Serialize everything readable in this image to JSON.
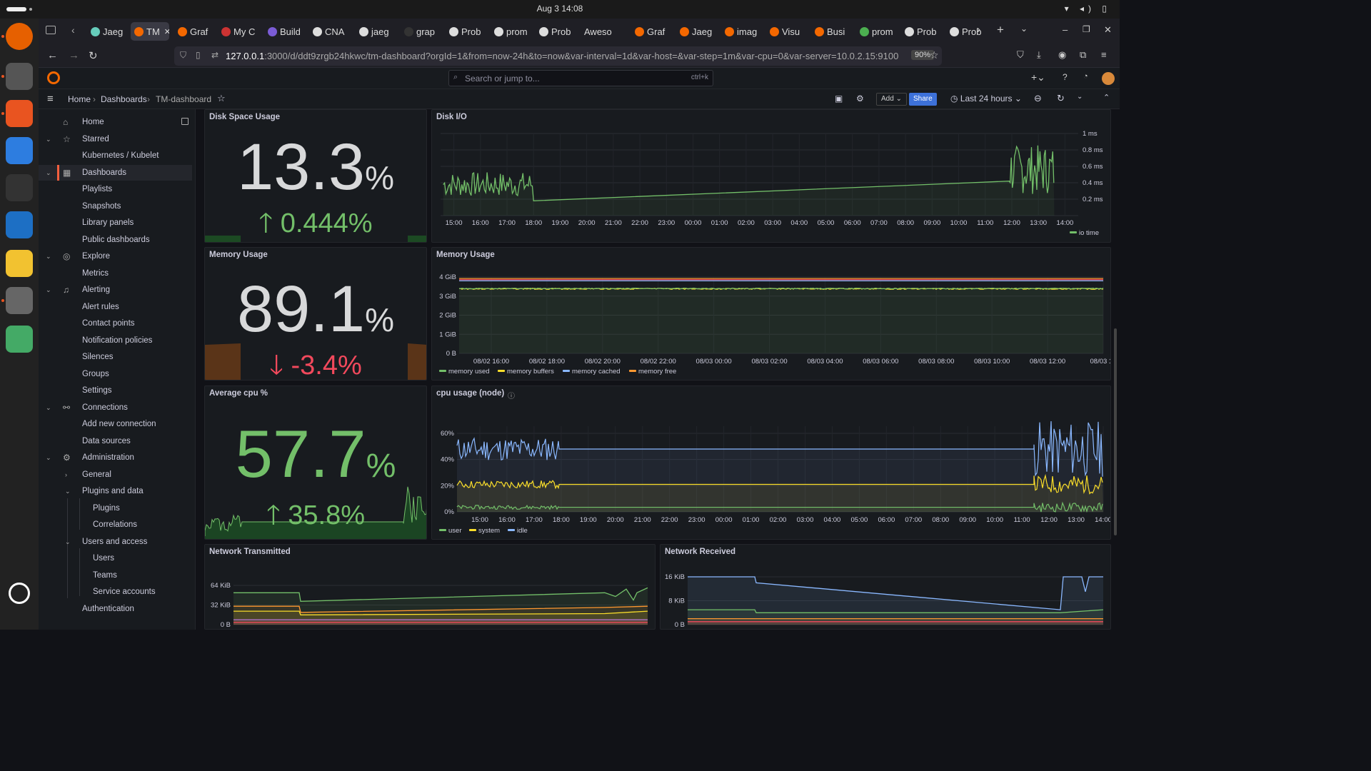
{
  "os": {
    "clock": "Aug 3  14:08"
  },
  "dock": [
    {
      "icon": "firefox-icon",
      "color": "#e66000"
    },
    {
      "icon": "files-icon",
      "color": "#555"
    },
    {
      "icon": "app-center-icon",
      "color": "#e95420"
    },
    {
      "icon": "help-icon",
      "color": "#2d7de0"
    },
    {
      "icon": "terminal-icon",
      "color": "#333"
    },
    {
      "icon": "vscode-icon",
      "color": "#1d6fc4"
    },
    {
      "icon": "text-editor-icon",
      "color": "#f2c230"
    },
    {
      "icon": "settings-icon",
      "color": "#666"
    },
    {
      "icon": "trash-icon",
      "color": "#4a6"
    },
    {
      "icon": "ubuntu-icon",
      "color": "#333"
    }
  ],
  "browser": {
    "tabs": [
      {
        "label": "Jaeg",
        "color": "#6cb"
      },
      {
        "label": "TM",
        "color": "#f46800",
        "active": true
      },
      {
        "label": "Graf",
        "color": "#f46800"
      },
      {
        "label": "My C",
        "color": "#c33"
      },
      {
        "label": "Build",
        "color": "#7b5cd6"
      },
      {
        "label": "CNA",
        "color": "#ddd"
      },
      {
        "label": "jaeg",
        "color": "#ddd"
      },
      {
        "label": "grap",
        "color": "#333"
      },
      {
        "label": "Prob",
        "color": "#ddd"
      },
      {
        "label": "prom",
        "color": "#ddd"
      },
      {
        "label": "Prob",
        "color": "#ddd"
      },
      {
        "label": "Aweso",
        "color": "none"
      },
      {
        "label": "Graf",
        "color": "#f46800"
      },
      {
        "label": "Jaeg",
        "color": "#f46800"
      },
      {
        "label": "imag",
        "color": "#f46800"
      },
      {
        "label": "Visu",
        "color": "#f46800"
      },
      {
        "label": "Busi",
        "color": "#f46800"
      },
      {
        "label": "prom",
        "color": "#4caf50"
      },
      {
        "label": "Prob",
        "color": "#ddd"
      },
      {
        "label": "Prob",
        "color": "#ddd"
      }
    ],
    "url_host": "127.0.0.1",
    "url_rest": ":3000/d/ddt9zrgb24hkwc/tm-dashboard?orgId=1&from=now-24h&to=now&var-interval=1d&var-host=&var-step=1m&var-cpu=0&var-server=10.0.2.15:9100",
    "zoom": "90%"
  },
  "grafana": {
    "search_placeholder": "Search or jump to...",
    "search_shortcut": "ctrl+k",
    "breadcrumb": [
      "Home",
      "Dashboards",
      "TM-dashboard"
    ],
    "add_label": "Add",
    "share_label": "Share",
    "time_range": "Last 24 hours"
  },
  "sidebar": [
    {
      "label": "Home",
      "level": 0,
      "icon": "home-icon"
    },
    {
      "label": "Starred",
      "level": 0,
      "icon": "star-icon",
      "chev": "v"
    },
    {
      "label": "Kubernetes / Kubelet",
      "level": 1
    },
    {
      "label": "Dashboards",
      "level": 0,
      "icon": "apps-icon",
      "chev": "v",
      "active": true
    },
    {
      "label": "Playlists",
      "level": 1
    },
    {
      "label": "Snapshots",
      "level": 1
    },
    {
      "label": "Library panels",
      "level": 1
    },
    {
      "label": "Public dashboards",
      "level": 1
    },
    {
      "label": "Explore",
      "level": 0,
      "icon": "compass-icon",
      "chev": "v"
    },
    {
      "label": "Metrics",
      "level": 1
    },
    {
      "label": "Alerting",
      "level": 0,
      "icon": "bell-icon",
      "chev": "v"
    },
    {
      "label": "Alert rules",
      "level": 1
    },
    {
      "label": "Contact points",
      "level": 1
    },
    {
      "label": "Notification policies",
      "level": 1
    },
    {
      "label": "Silences",
      "level": 1
    },
    {
      "label": "Groups",
      "level": 1
    },
    {
      "label": "Settings",
      "level": 1
    },
    {
      "label": "Connections",
      "level": 0,
      "icon": "plug-icon",
      "chev": "v"
    },
    {
      "label": "Add new connection",
      "level": 1
    },
    {
      "label": "Data sources",
      "level": 1
    },
    {
      "label": "Administration",
      "level": 0,
      "icon": "cog-icon",
      "chev": "v"
    },
    {
      "label": "General",
      "level": 1,
      "chev": ">"
    },
    {
      "label": "Plugins and data",
      "level": 1,
      "chev": "v"
    },
    {
      "label": "Plugins",
      "level": 2
    },
    {
      "label": "Correlations",
      "level": 2
    },
    {
      "label": "Users and access",
      "level": 1,
      "chev": "v"
    },
    {
      "label": "Users",
      "level": 2
    },
    {
      "label": "Teams",
      "level": 2
    },
    {
      "label": "Service accounts",
      "level": 2
    },
    {
      "label": "Authentication",
      "level": 1
    }
  ],
  "stats": [
    {
      "title": "Disk Space Usage",
      "value": "13.3",
      "unit": "%",
      "delta": "0.444%",
      "dir": "up",
      "color": "#d8d9da",
      "delta_color": "#73bf69",
      "spark_color": "#73bf69"
    },
    {
      "title": "Memory Usage",
      "value": "89.1",
      "unit": "%",
      "delta": "-3.4%",
      "dir": "down",
      "color": "#d8d9da",
      "delta_color": "#f2495c",
      "spark_color": "#ff9830"
    },
    {
      "title": "Average cpu %",
      "value": "57.7",
      "unit": "%",
      "delta": "35.8%",
      "dir": "up",
      "color": "#73bf69",
      "delta_color": "#73bf69",
      "spark_color": "#73bf69"
    }
  ],
  "chart_data": [
    {
      "type": "line",
      "title": "Disk I/O",
      "x": [
        "15:00",
        "16:00",
        "17:00",
        "18:00",
        "19:00",
        "20:00",
        "21:00",
        "22:00",
        "23:00",
        "00:00",
        "01:00",
        "02:00",
        "03:00",
        "04:00",
        "05:00",
        "06:00",
        "07:00",
        "08:00",
        "09:00",
        "10:00",
        "11:00",
        "12:00",
        "13:00",
        "14:00"
      ],
      "y_ticks": [
        "0.2 ms",
        "0.4 ms",
        "0.6 ms",
        "0.8 ms",
        "1 ms"
      ],
      "ylim": [
        0,
        1.0
      ],
      "series": [
        {
          "name": "io time",
          "color": "#73bf69",
          "points": [
            [
              14.6,
              0.18
            ],
            [
              15.2,
              0.45
            ],
            [
              16,
              0.4
            ],
            [
              17,
              0.45
            ],
            [
              17.9,
              0.45
            ],
            [
              18,
              0.18
            ],
            [
              24,
              0.4
            ],
            [
              35.9,
              0.45
            ],
            [
              36.5,
              0.65
            ],
            [
              37.2,
              0.5
            ],
            [
              37.6,
              0.72
            ]
          ]
        }
      ]
    },
    {
      "type": "line",
      "title": "Memory Usage",
      "x": [
        "08/02 16:00",
        "08/02 18:00",
        "08/02 20:00",
        "08/02 22:00",
        "08/03 00:00",
        "08/03 02:00",
        "08/03 04:00",
        "08/03 06:00",
        "08/03 08:00",
        "08/03 10:00",
        "08/03 12:00",
        "08/03 14"
      ],
      "y_ticks": [
        "0 B",
        "1 GiB",
        "2 GiB",
        "3 GiB",
        "4 GiB"
      ],
      "ylim": [
        0,
        4
      ],
      "series": [
        {
          "name": "memory used",
          "color": "#73bf69",
          "values": [
            3.4,
            3.38,
            3.36
          ]
        },
        {
          "name": "memory buffers",
          "color": "#fade2a",
          "values": [
            3.4,
            3.38,
            3.36
          ]
        },
        {
          "name": "memory cached",
          "color": "#8ab8ff",
          "values": [
            3.78,
            3.78,
            3.78
          ]
        },
        {
          "name": "memory free",
          "color": "#ff9830",
          "values": [
            3.9,
            3.9,
            3.9
          ]
        }
      ]
    },
    {
      "type": "line",
      "title": "cpu usage (node)",
      "x": [
        "15:00",
        "16:00",
        "17:00",
        "18:00",
        "19:00",
        "20:00",
        "21:00",
        "22:00",
        "23:00",
        "00:00",
        "01:00",
        "02:00",
        "03:00",
        "04:00",
        "05:00",
        "06:00",
        "07:00",
        "08:00",
        "09:00",
        "10:00",
        "11:00",
        "12:00",
        "13:00",
        "14:00"
      ],
      "y_ticks": [
        "0%",
        "20%",
        "40%",
        "60%"
      ],
      "ylim": [
        0,
        70
      ],
      "series": [
        {
          "name": "user",
          "color": "#73bf69",
          "values": [
            4,
            3,
            3
          ]
        },
        {
          "name": "system",
          "color": "#fade2a",
          "values": [
            22,
            20,
            20
          ]
        },
        {
          "name": "idle",
          "color": "#8ab8ff",
          "values": [
            48,
            48,
            48
          ]
        }
      ]
    },
    {
      "type": "line",
      "title": "Network Transmitted",
      "y_ticks": [
        "0 B",
        "32 KiB",
        "64 KiB"
      ],
      "ylim": [
        0,
        80
      ]
    },
    {
      "type": "line",
      "title": "Network Received",
      "y_ticks": [
        "0 B",
        "8 KiB",
        "16 KiB"
      ],
      "ylim": [
        0,
        18
      ]
    }
  ]
}
